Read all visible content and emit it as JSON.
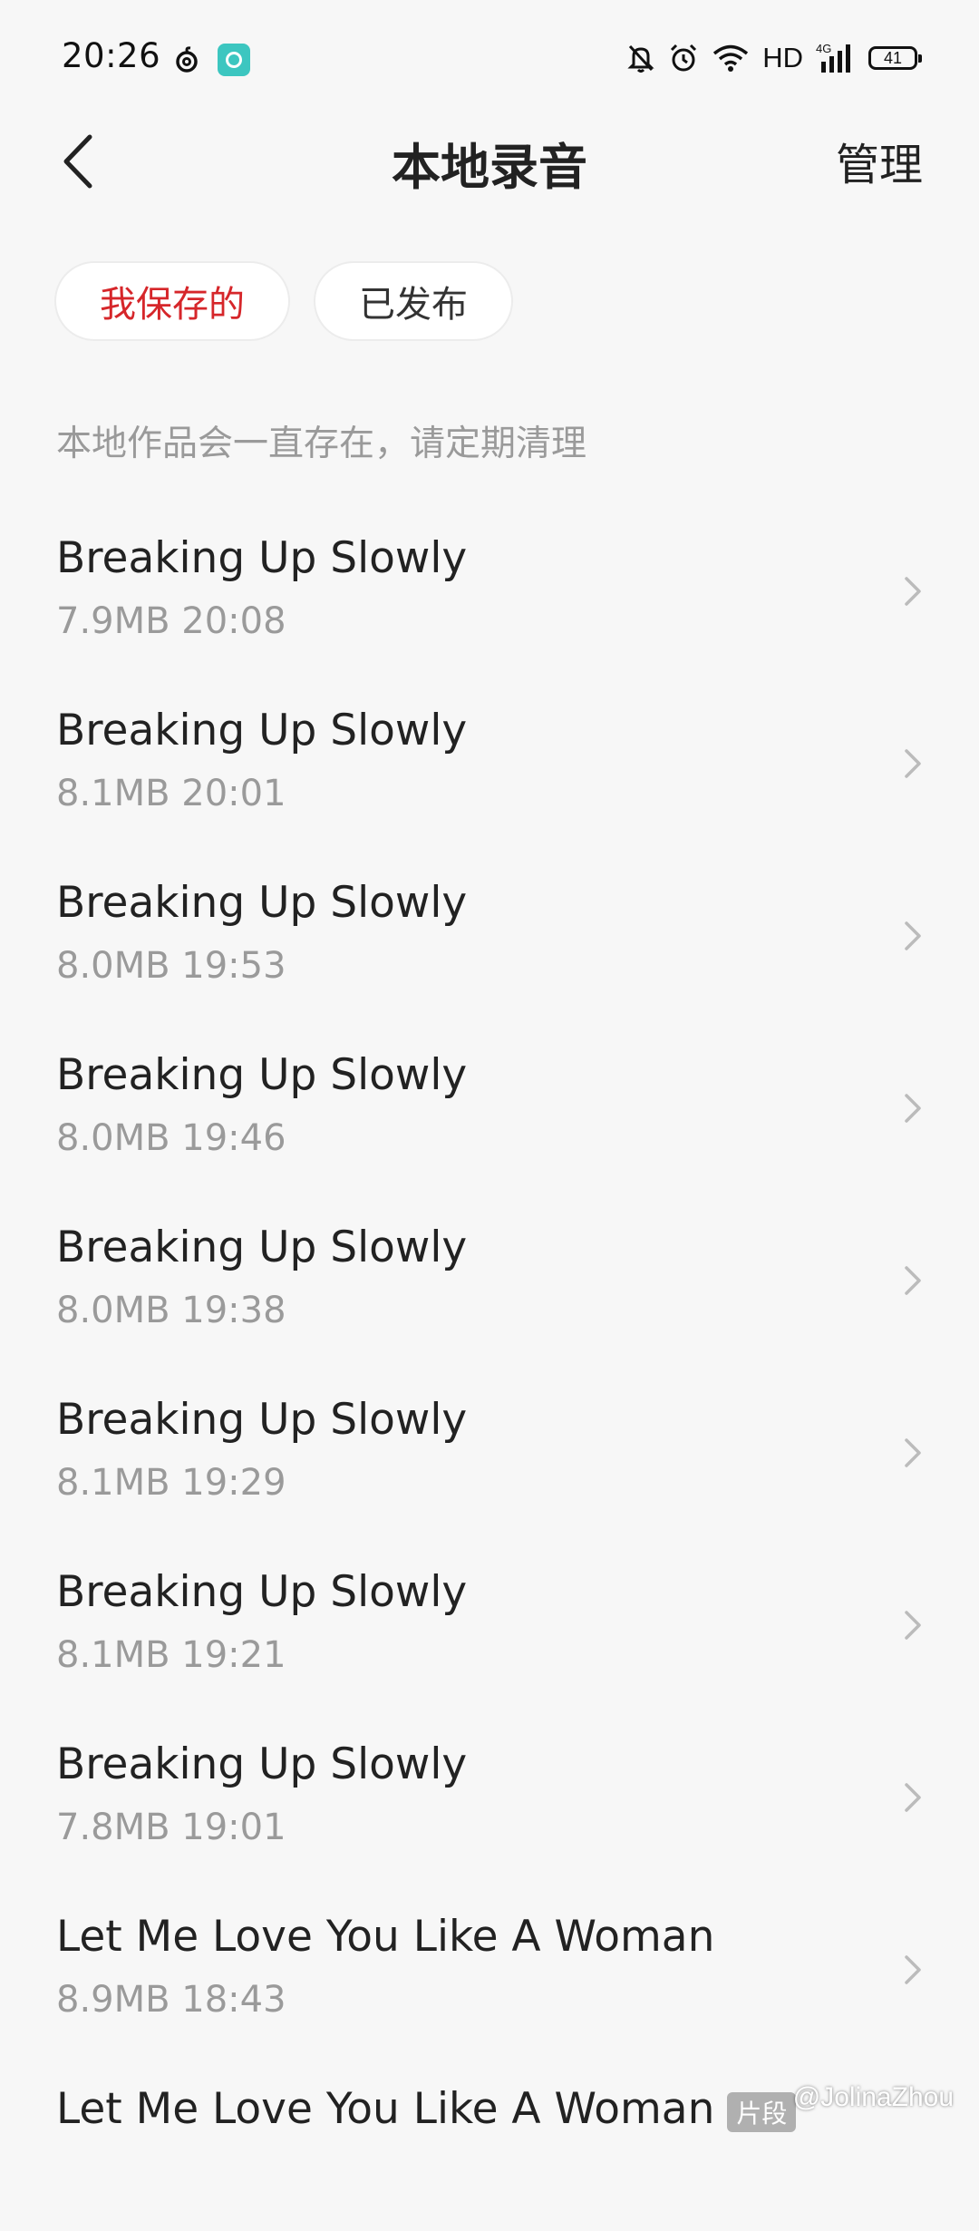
{
  "status_bar": {
    "time": "20:26",
    "network": "HD",
    "signal_label": "4G",
    "battery": "41",
    "icons": [
      "netease-music-icon",
      "chat-app-icon",
      "mute-icon",
      "alarm-icon",
      "wifi-icon",
      "signal-icon",
      "battery-icon"
    ]
  },
  "header": {
    "back_icon": "chevron-left-icon",
    "title": "本地录音",
    "manage_label": "管理"
  },
  "tabs": [
    {
      "label": "我保存的",
      "active": true
    },
    {
      "label": "已发布",
      "active": false
    }
  ],
  "notice": "本地作品会一直存在，请定期清理",
  "recordings": [
    {
      "title": "Breaking Up Slowly",
      "meta": "7.9MB 20:08"
    },
    {
      "title": "Breaking Up Slowly",
      "meta": "8.1MB 20:01"
    },
    {
      "title": "Breaking Up Slowly",
      "meta": "8.0MB 19:53"
    },
    {
      "title": "Breaking Up Slowly",
      "meta": "8.0MB 19:46"
    },
    {
      "title": "Breaking Up Slowly",
      "meta": "8.0MB 19:38"
    },
    {
      "title": "Breaking Up Slowly",
      "meta": "8.1MB 19:29"
    },
    {
      "title": "Breaking Up Slowly",
      "meta": "8.1MB 19:21"
    },
    {
      "title": "Breaking Up Slowly",
      "meta": "7.8MB 19:01"
    },
    {
      "title": "Let Me Love You Like A Woman",
      "meta": "8.9MB 18:43"
    },
    {
      "title": "Let Me Love You Like A Woman",
      "meta": "",
      "badge": "片段"
    }
  ],
  "watermark": "@JolinaZhou",
  "colors": {
    "accent": "#d6262a",
    "background": "#f7f7f7",
    "secondary_text": "#9a9a9a"
  }
}
